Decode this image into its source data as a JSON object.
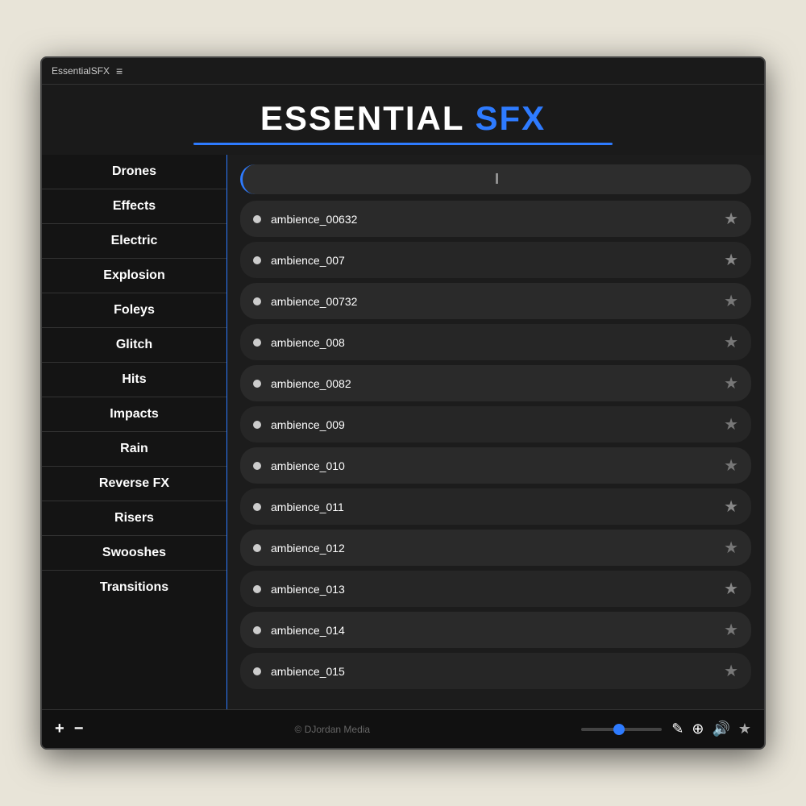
{
  "titleBar": {
    "appName": "EssentialSFX",
    "menuIcon": "≡"
  },
  "header": {
    "titleWhite": "ESSENTIAL",
    "titleBlue": "SFX"
  },
  "sidebar": {
    "items": [
      {
        "label": "Drones",
        "active": false
      },
      {
        "label": "Effects",
        "active": true
      },
      {
        "label": "Electric",
        "active": false
      },
      {
        "label": "Explosion",
        "active": false
      },
      {
        "label": "Foleys",
        "active": false
      },
      {
        "label": "Glitch",
        "active": false
      },
      {
        "label": "Hits",
        "active": false
      },
      {
        "label": "Impacts",
        "active": false
      },
      {
        "label": "Rain",
        "active": false
      },
      {
        "label": "Reverse FX",
        "active": false
      },
      {
        "label": "Risers",
        "active": false
      },
      {
        "label": "Swooshes",
        "active": false
      },
      {
        "label": "Transitions",
        "active": false
      }
    ]
  },
  "tracks": [
    {
      "name": "ambience_00632",
      "starred": true,
      "darker": false
    },
    {
      "name": "ambience_007",
      "starred": true,
      "darker": true
    },
    {
      "name": "ambience_00732",
      "starred": false,
      "darker": false
    },
    {
      "name": "ambience_008",
      "starred": false,
      "darker": true
    },
    {
      "name": "ambience_0082",
      "starred": false,
      "darker": false
    },
    {
      "name": "ambience_009",
      "starred": false,
      "darker": true
    },
    {
      "name": "ambience_010",
      "starred": false,
      "darker": false
    },
    {
      "name": "ambience_011",
      "starred": true,
      "darker": true
    },
    {
      "name": "ambience_012",
      "starred": false,
      "darker": false
    },
    {
      "name": "ambience_013",
      "starred": true,
      "darker": true
    },
    {
      "name": "ambience_014",
      "starred": false,
      "darker": false
    },
    {
      "name": "ambience_015",
      "starred": false,
      "darker": true
    }
  ],
  "bottomBar": {
    "addLabel": "+",
    "removeLabel": "−",
    "copyright": "© DJordan Media",
    "icons": {
      "edit": "✎",
      "globe": "⊕",
      "speaker": "◀)",
      "star": "★"
    }
  }
}
